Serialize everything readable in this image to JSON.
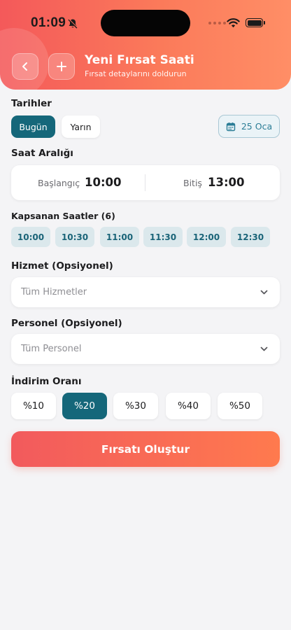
{
  "status_bar": {
    "time": "01:09"
  },
  "header": {
    "back_icon": "chevron-left-icon",
    "add_icon": "plus-icon",
    "title": "Yeni Fırsat Saati",
    "subtitle": "Fırsat detaylarını doldurun"
  },
  "dates": {
    "label": "Tarihler",
    "options": [
      "Bugün",
      "Yarın"
    ],
    "selected": "Bugün",
    "picker_value": "25 Oca",
    "picker_icon": "calendar-icon"
  },
  "time_range": {
    "label": "Saat Aralığı",
    "start_label": "Başlangıç",
    "start_value": "10:00",
    "end_label": "Bitiş",
    "end_value": "13:00"
  },
  "covered_hours": {
    "label": "Kapsanan Saatler (6)",
    "slots": [
      "10:00",
      "10:30",
      "11:00",
      "11:30",
      "12:00",
      "12:30"
    ]
  },
  "service": {
    "label": "Hizmet (Opsiyonel)",
    "placeholder": "Tüm Hizmetler"
  },
  "staff": {
    "label": "Personel (Opsiyonel)",
    "placeholder": "Tüm Personel"
  },
  "discount": {
    "label": "İndirim Oranı",
    "options": [
      "%10",
      "%20",
      "%30",
      "%40",
      "%50"
    ],
    "selected": "%20"
  },
  "submit_label": "Fırsatı Oluştur",
  "colors": {
    "accent": "#15677a",
    "header_gradient_start": "#f4595a",
    "header_gradient_end": "#ff8e66"
  }
}
